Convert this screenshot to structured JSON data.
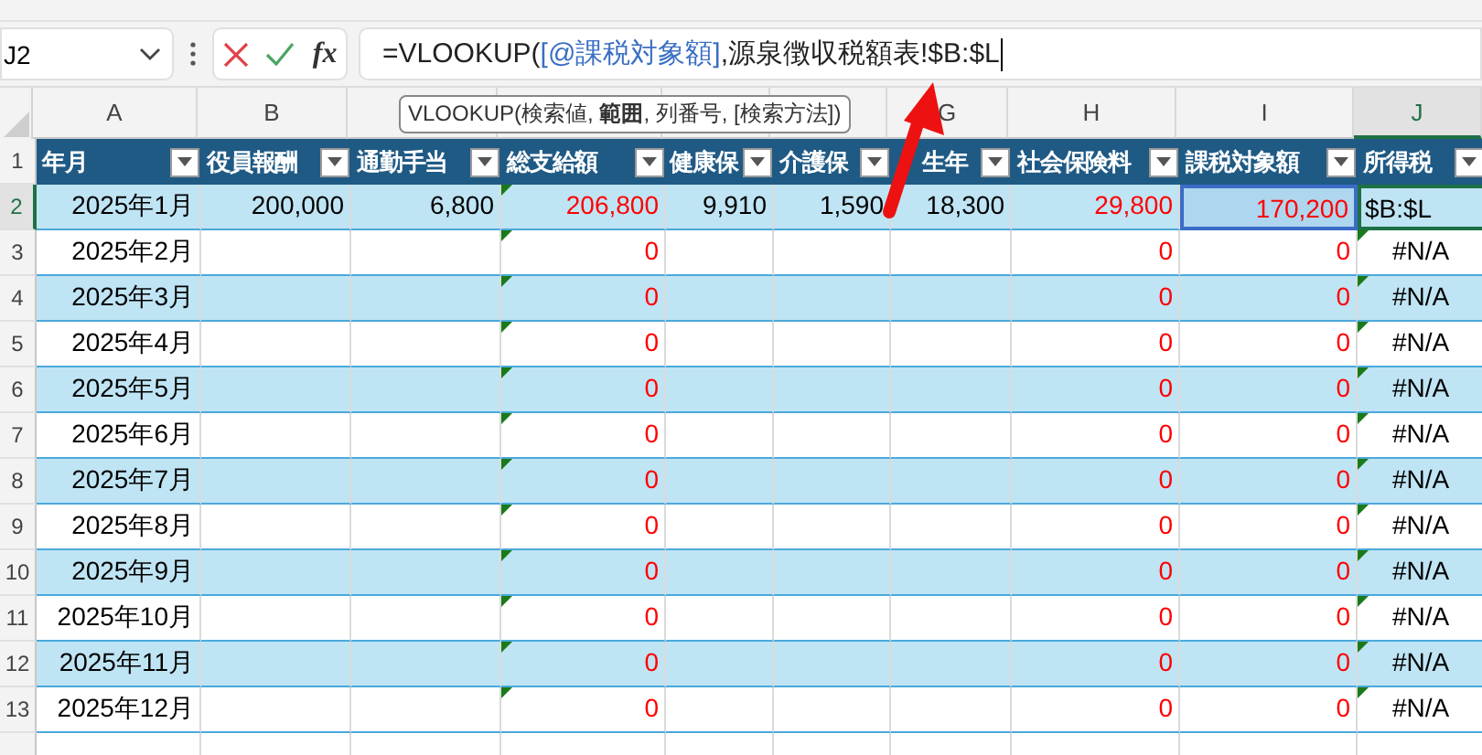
{
  "formula_bar": {
    "name_box": "J2",
    "function_label": "fx",
    "formula": [
      {
        "kind": "plain",
        "text": "=VLOOKUP("
      },
      {
        "kind": "reference",
        "text": "[@課税対象額]"
      },
      {
        "kind": "plain",
        "text": ",源泉徴収税額表!$B:$L"
      }
    ]
  },
  "tooltip": "VLOOKUP(検索値, **範囲**, 列番号, [検索方法])",
  "columns": [
    {
      "letter": "A",
      "selected": false,
      "header": "年月",
      "color": "#000000"
    },
    {
      "letter": "B",
      "selected": false,
      "header": "役員報酬",
      "color": "#000000"
    },
    {
      "selected": false,
      "header": "通勤手当",
      "color": "#000000"
    },
    {
      "selected": false,
      "header": "総支給額",
      "color": "#ff0000"
    },
    {
      "selected": false,
      "header": "健康保",
      "color": "#000000"
    },
    {
      "selected": false,
      "header": "介護保",
      "color": "#000000"
    },
    {
      "letter": "G",
      "selected": false,
      "header": "生年",
      "color": "#000000"
    },
    {
      "letter": "H",
      "selected": false,
      "header": "社会保険料",
      "color": "#ff0000"
    },
    {
      "letter": "I",
      "selected": false,
      "header": "課税対象額",
      "color": "#ff0000"
    },
    {
      "letter": "J",
      "selected": true,
      "header": "所得税",
      "color": "#000000"
    }
  ],
  "row_numbers": [
    {
      "label": "1",
      "selected": false
    },
    {
      "label": "2",
      "selected": true
    },
    {
      "label": "3",
      "selected": false
    },
    {
      "label": "4",
      "selected": false
    },
    {
      "label": "5",
      "selected": false
    },
    {
      "label": "6",
      "selected": false
    },
    {
      "label": "7",
      "selected": false
    },
    {
      "label": "8",
      "selected": false
    },
    {
      "label": "9",
      "selected": false
    },
    {
      "label": "10",
      "selected": false
    },
    {
      "label": "11",
      "selected": false
    },
    {
      "label": "12",
      "selected": false
    },
    {
      "label": "13",
      "selected": false
    }
  ],
  "rows": [
    {
      "cells": [
        {
          "kind": "value",
          "text": "2025年1月",
          "flagged": false
        },
        {
          "kind": "value",
          "text": "200,000",
          "flagged": false
        },
        {
          "kind": "value",
          "text": "6,800",
          "flagged": false
        },
        {
          "kind": "value",
          "text": "206,800",
          "flagged": true
        },
        {
          "kind": "value",
          "text": "9,910",
          "flagged": false
        },
        {
          "kind": "value",
          "text": "1,590",
          "flagged": false
        },
        {
          "kind": "value",
          "text": "18,300",
          "flagged": false
        },
        {
          "kind": "value",
          "text": "29,800",
          "flagged": false
        },
        {
          "kind": "reference",
          "text": "170,200",
          "flagged": false
        },
        {
          "kind": "edit",
          "text": "$B:$L",
          "flagged": false
        }
      ]
    },
    {
      "cells": [
        {
          "kind": "value",
          "text": "2025年2月",
          "flagged": false
        },
        {
          "kind": "empty",
          "flagged": false
        },
        {
          "kind": "empty",
          "flagged": false
        },
        {
          "kind": "value",
          "text": "0",
          "flagged": true
        },
        {
          "kind": "empty",
          "flagged": false
        },
        {
          "kind": "empty",
          "flagged": false
        },
        {
          "kind": "empty",
          "flagged": false
        },
        {
          "kind": "value",
          "text": "0",
          "flagged": false
        },
        {
          "kind": "value",
          "text": "0",
          "flagged": false
        },
        {
          "kind": "error",
          "text": "#N/A",
          "flagged": true
        }
      ]
    },
    {
      "cells": [
        {
          "kind": "value",
          "text": "2025年3月",
          "flagged": false
        },
        {
          "kind": "empty",
          "flagged": false
        },
        {
          "kind": "empty",
          "flagged": false
        },
        {
          "kind": "value",
          "text": "0",
          "flagged": true
        },
        {
          "kind": "empty",
          "flagged": false
        },
        {
          "kind": "empty",
          "flagged": false
        },
        {
          "kind": "empty",
          "flagged": false
        },
        {
          "kind": "value",
          "text": "0",
          "flagged": false
        },
        {
          "kind": "value",
          "text": "0",
          "flagged": false
        },
        {
          "kind": "error",
          "text": "#N/A",
          "flagged": true
        }
      ]
    },
    {
      "cells": [
        {
          "kind": "value",
          "text": "2025年4月",
          "flagged": false
        },
        {
          "kind": "empty",
          "flagged": false
        },
        {
          "kind": "empty",
          "flagged": false
        },
        {
          "kind": "value",
          "text": "0",
          "flagged": true
        },
        {
          "kind": "empty",
          "flagged": false
        },
        {
          "kind": "empty",
          "flagged": false
        },
        {
          "kind": "empty",
          "flagged": false
        },
        {
          "kind": "value",
          "text": "0",
          "flagged": false
        },
        {
          "kind": "value",
          "text": "0",
          "flagged": false
        },
        {
          "kind": "error",
          "text": "#N/A",
          "flagged": true
        }
      ]
    },
    {
      "cells": [
        {
          "kind": "value",
          "text": "2025年5月",
          "flagged": false
        },
        {
          "kind": "empty",
          "flagged": false
        },
        {
          "kind": "empty",
          "flagged": false
        },
        {
          "kind": "value",
          "text": "0",
          "flagged": true
        },
        {
          "kind": "empty",
          "flagged": false
        },
        {
          "kind": "empty",
          "flagged": false
        },
        {
          "kind": "empty",
          "flagged": false
        },
        {
          "kind": "value",
          "text": "0",
          "flagged": false
        },
        {
          "kind": "value",
          "text": "0",
          "flagged": false
        },
        {
          "kind": "error",
          "text": "#N/A",
          "flagged": true
        }
      ]
    },
    {
      "cells": [
        {
          "kind": "value",
          "text": "2025年6月",
          "flagged": false
        },
        {
          "kind": "empty",
          "flagged": false
        },
        {
          "kind": "empty",
          "flagged": false
        },
        {
          "kind": "value",
          "text": "0",
          "flagged": true
        },
        {
          "kind": "empty",
          "flagged": false
        },
        {
          "kind": "empty",
          "flagged": false
        },
        {
          "kind": "empty",
          "flagged": false
        },
        {
          "kind": "value",
          "text": "0",
          "flagged": false
        },
        {
          "kind": "value",
          "text": "0",
          "flagged": false
        },
        {
          "kind": "error",
          "text": "#N/A",
          "flagged": true
        }
      ]
    },
    {
      "cells": [
        {
          "kind": "value",
          "text": "2025年7月",
          "flagged": false
        },
        {
          "kind": "empty",
          "flagged": false
        },
        {
          "kind": "empty",
          "flagged": false
        },
        {
          "kind": "value",
          "text": "0",
          "flagged": true
        },
        {
          "kind": "empty",
          "flagged": false
        },
        {
          "kind": "empty",
          "flagged": false
        },
        {
          "kind": "empty",
          "flagged": false
        },
        {
          "kind": "value",
          "text": "0",
          "flagged": false
        },
        {
          "kind": "value",
          "text": "0",
          "flagged": false
        },
        {
          "kind": "error",
          "text": "#N/A",
          "flagged": true
        }
      ]
    },
    {
      "cells": [
        {
          "kind": "value",
          "text": "2025年8月",
          "flagged": false
        },
        {
          "kind": "empty",
          "flagged": false
        },
        {
          "kind": "empty",
          "flagged": false
        },
        {
          "kind": "value",
          "text": "0",
          "flagged": true
        },
        {
          "kind": "empty",
          "flagged": false
        },
        {
          "kind": "empty",
          "flagged": false
        },
        {
          "kind": "empty",
          "flagged": false
        },
        {
          "kind": "value",
          "text": "0",
          "flagged": false
        },
        {
          "kind": "value",
          "text": "0",
          "flagged": false
        },
        {
          "kind": "error",
          "text": "#N/A",
          "flagged": true
        }
      ]
    },
    {
      "cells": [
        {
          "kind": "value",
          "text": "2025年9月",
          "flagged": false
        },
        {
          "kind": "empty",
          "flagged": false
        },
        {
          "kind": "empty",
          "flagged": false
        },
        {
          "kind": "value",
          "text": "0",
          "flagged": true
        },
        {
          "kind": "empty",
          "flagged": false
        },
        {
          "kind": "empty",
          "flagged": false
        },
        {
          "kind": "empty",
          "flagged": false
        },
        {
          "kind": "value",
          "text": "0",
          "flagged": false
        },
        {
          "kind": "value",
          "text": "0",
          "flagged": false
        },
        {
          "kind": "error",
          "text": "#N/A",
          "flagged": true
        }
      ]
    },
    {
      "cells": [
        {
          "kind": "value",
          "text": "2025年10月",
          "flagged": false
        },
        {
          "kind": "empty",
          "flagged": false
        },
        {
          "kind": "empty",
          "flagged": false
        },
        {
          "kind": "value",
          "text": "0",
          "flagged": true
        },
        {
          "kind": "empty",
          "flagged": false
        },
        {
          "kind": "empty",
          "flagged": false
        },
        {
          "kind": "empty",
          "flagged": false
        },
        {
          "kind": "value",
          "text": "0",
          "flagged": false
        },
        {
          "kind": "value",
          "text": "0",
          "flagged": false
        },
        {
          "kind": "error",
          "text": "#N/A",
          "flagged": true
        }
      ]
    },
    {
      "cells": [
        {
          "kind": "value",
          "text": "2025年11月",
          "flagged": false
        },
        {
          "kind": "empty",
          "flagged": false
        },
        {
          "kind": "empty",
          "flagged": false
        },
        {
          "kind": "value",
          "text": "0",
          "flagged": true
        },
        {
          "kind": "empty",
          "flagged": false
        },
        {
          "kind": "empty",
          "flagged": false
        },
        {
          "kind": "empty",
          "flagged": false
        },
        {
          "kind": "value",
          "text": "0",
          "flagged": false
        },
        {
          "kind": "value",
          "text": "0",
          "flagged": false
        },
        {
          "kind": "error",
          "text": "#N/A",
          "flagged": true
        }
      ]
    },
    {
      "cells": [
        {
          "kind": "value",
          "text": "2025年12月",
          "flagged": false
        },
        {
          "kind": "empty",
          "flagged": false
        },
        {
          "kind": "empty",
          "flagged": false
        },
        {
          "kind": "value",
          "text": "0",
          "flagged": true
        },
        {
          "kind": "empty",
          "flagged": false
        },
        {
          "kind": "empty",
          "flagged": false
        },
        {
          "kind": "empty",
          "flagged": false
        },
        {
          "kind": "value",
          "text": "0",
          "flagged": false
        },
        {
          "kind": "value",
          "text": "0",
          "flagged": false
        },
        {
          "kind": "error",
          "text": "#N/A",
          "flagged": true
        }
      ]
    }
  ]
}
